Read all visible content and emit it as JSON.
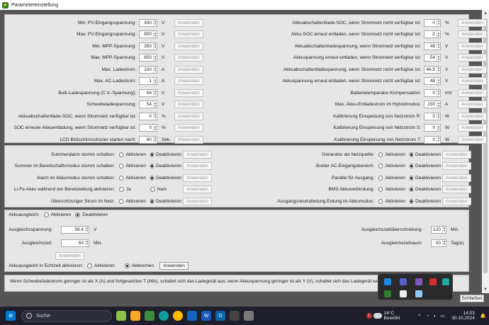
{
  "window": {
    "title": "Parametereinstellung"
  },
  "common": {
    "apply": "Anwenden"
  },
  "left_params": [
    {
      "label": "Min. PV-Eingangsspannung:",
      "value": "300",
      "unit": "V"
    },
    {
      "label": "Max. PV-Eingangsspannung:",
      "value": "900",
      "unit": "V"
    },
    {
      "label": "Min. MPP-Spannung:",
      "value": "350",
      "unit": "V"
    },
    {
      "label": "Max. MPP-Spannung:",
      "value": "850",
      "unit": "V"
    },
    {
      "label": "Max. Ladestrom:",
      "value": "100",
      "unit": "A"
    },
    {
      "label": "Max. AC-Ladestrom:",
      "value": "1",
      "unit": "A"
    },
    {
      "label": "Bulk-Ladespannung (C.V.-Spannung):",
      "value": "56",
      "unit": "V"
    },
    {
      "label": "Schwebeladespannung:",
      "value": "54",
      "unit": "V"
    },
    {
      "label": "Akkuabschaltentlade-SOC, wenn Stromnetz verfügbar ist:",
      "value": "0",
      "unit": "%"
    },
    {
      "label": "SOC erneute Akkuentladung, wenn Stromnetz verfügbar ist:",
      "value": "0",
      "unit": "%"
    },
    {
      "label": "LCD-Bildschirmschoner starten nach:",
      "value": "60",
      "unit": "Sek."
    }
  ],
  "right_params": [
    {
      "label": "Akkuabschaltentlade-SOC, wenn Stromnetz nicht verfügbar ist:",
      "value": "0",
      "unit": "%"
    },
    {
      "label": "Akku-SOC erneut entladen, wenn Stromnetz nicht verfügbar ist:",
      "value": "0",
      "unit": "%"
    },
    {
      "label": "Akkuabschaltentladespannung, wenn Stromnetz verfügbar ist:",
      "value": "48",
      "unit": "V"
    },
    {
      "label": "Akkuspannung erneut entladen, wenn Stromnetz verfügbar ist:",
      "value": "54",
      "unit": "V"
    },
    {
      "label": "Akkuabschaltentladespannung, wenn Stromnetz nicht verfügbar ist:",
      "value": "46.5",
      "unit": "V"
    },
    {
      "label": "Akkuspannung erneut entladen, wenn Stromnetz nicht verfügbar ist:",
      "value": "48",
      "unit": "V"
    },
    {
      "label": "Batterietemperatur-Kompensation:",
      "value": "0",
      "unit": "mV"
    },
    {
      "label": "Max. Akku-Entladestrom im Hybridmodus:",
      "value": "150",
      "unit": "A"
    },
    {
      "label": "Kalibrierung Einspeisung von Netzstrom R:",
      "value": "0",
      "unit": "W"
    },
    {
      "label": "Kalibrierung Einspeisung von Netzstrom S:",
      "value": "0",
      "unit": "W"
    },
    {
      "label": "Kalibrierung Einspeisung von Netzstrom T:",
      "value": "0",
      "unit": "W"
    }
  ],
  "left_toggles": [
    {
      "label": "Summeralarm stumm schalten:",
      "opt1": "Aktivieren",
      "opt2": "Deaktivieren",
      "selected": 2
    },
    {
      "label": "Summer im Bereitschaftsmodus stumm schalten:",
      "opt1": "Aktivieren",
      "opt2": "Deaktivieren",
      "selected": 2
    },
    {
      "label": "Alarm im Akkumodus stumm schalten:",
      "opt1": "Aktivieren",
      "opt2": "Deaktivieren",
      "selected": 2
    },
    {
      "label": "Li-Fe-Akku während der Bereitstellung aktivieren:",
      "opt1": "Ja",
      "opt2": "Nein",
      "selected": 0
    },
    {
      "label": "Überschüssiger Strom im Netz:",
      "opt1": "Aktivieren",
      "opt2": "Deaktivieren",
      "selected": 2
    }
  ],
  "right_toggles": [
    {
      "label": "Generator als Netzquelle:",
      "opt1": "Aktivieren",
      "opt2": "Deaktivieren",
      "selected": 2
    },
    {
      "label": "Breiter AC-Eingangsbereich:",
      "opt1": "Aktivieren",
      "opt2": "Deaktivieren",
      "selected": 2
    },
    {
      "label": "Parallel für Ausgang:",
      "opt1": "Aktivieren",
      "opt2": "Deaktivieren",
      "selected": 2
    },
    {
      "label": "BMS-Akkuverbindung:",
      "opt1": "Aktivieren",
      "opt2": "Deaktivieren",
      "selected": 2
    },
    {
      "label": "Ausgangsneutralleitung Erdung im Akkumodus:",
      "opt1": "Aktivieren",
      "opt2": "Deaktivieren",
      "selected": 2
    }
  ],
  "balance": {
    "label": "Akkuausgleich:",
    "opt1": "Aktivieren",
    "opt2": "Deaktivieren",
    "selected": 2,
    "voltage_label": "Ausgleichsspannung:",
    "voltage_value": "58.4",
    "voltage_unit": "V",
    "time_label": "Ausgleichszeit:",
    "time_value": "60",
    "time_unit": "Min.",
    "timeout_label": "Ausgleichszeitüberschreitung:",
    "timeout_value": "120",
    "timeout_unit": "Min.",
    "period_label": "Ausgleichszeitraum:",
    "period_value": "30",
    "period_unit": "Tag(e)",
    "realtime_label": "Akkuausgleich in Echtzeit aktivieren:",
    "realtime_opt1": "Aktivieren",
    "realtime_opt2": "Abbrechen",
    "realtime_selected": 2
  },
  "footer": {
    "info": "Wenn Schwebeladestrom geringer ist als X (A) und fortgesetztes T (Min), schaltet sich das Ladegerät aus; wenn Akkuspannung geringer ist als Y (V), schaltet sich das Ladegerät wieder ein.",
    "close": "Schließen"
  },
  "taskbar": {
    "search_placeholder": "Suche",
    "weather_temp": "14°C",
    "weather_desc": "Bewölkt",
    "weather_badge": "1",
    "time": "14:03",
    "date": "30.10.2024"
  }
}
